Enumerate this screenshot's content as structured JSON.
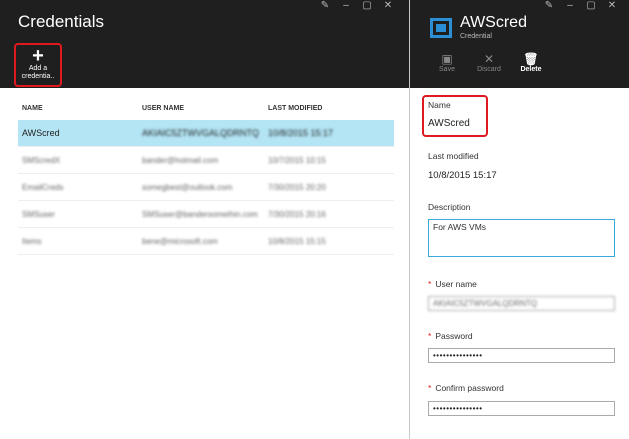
{
  "left_blade": {
    "title": "Credentials",
    "add_button": {
      "line1": "Add a",
      "line2": "credentia.."
    },
    "columns": [
      "NAME",
      "USER NAME",
      "LAST MODIFIED"
    ],
    "rows": [
      {
        "name": "AWScred",
        "user": "AKIAIC5ZTWVGALQDRNTQ",
        "modified": "10/8/2015 15:17"
      },
      {
        "name": "SMScredX",
        "user": "bander@hotmail.com",
        "modified": "10/7/2015 10:15"
      },
      {
        "name": "EmailCreds",
        "user": "somegbest@outlook.com",
        "modified": "7/30/2015 20:20"
      },
      {
        "name": "SMSuser",
        "user": "SMSuser@bandersomethin.com",
        "modified": "7/30/2015 20:16"
      },
      {
        "name": "Items",
        "user": "bene@microsoft.com",
        "modified": "10/8/2015 15:15"
      }
    ]
  },
  "right_blade": {
    "title": "AWScred",
    "subtitle": "Credential",
    "commands": {
      "save": "Save",
      "discard": "Discard",
      "delete": "Delete"
    },
    "name_label": "Name",
    "name_value": "AWScred",
    "last_modified_label": "Last modified",
    "last_modified_value": "10/8/2015 15:17",
    "description_label": "Description",
    "description_value": "For AWS VMs",
    "user_name_label": "User name",
    "user_name_value": "AKIAIC5ZTWVGALQDRNTQ",
    "password_label": "Password",
    "password_value": "•••••••••••••••",
    "confirm_password_label": "Confirm password",
    "confirm_password_value": "•••••••••••••••",
    "required_mark": "*"
  },
  "colors": {
    "header_bg": "#1f1f1f",
    "selection": "#b4e5f5",
    "highlight_red": "#e0191e",
    "resource_icon": "#2a8fd4"
  }
}
